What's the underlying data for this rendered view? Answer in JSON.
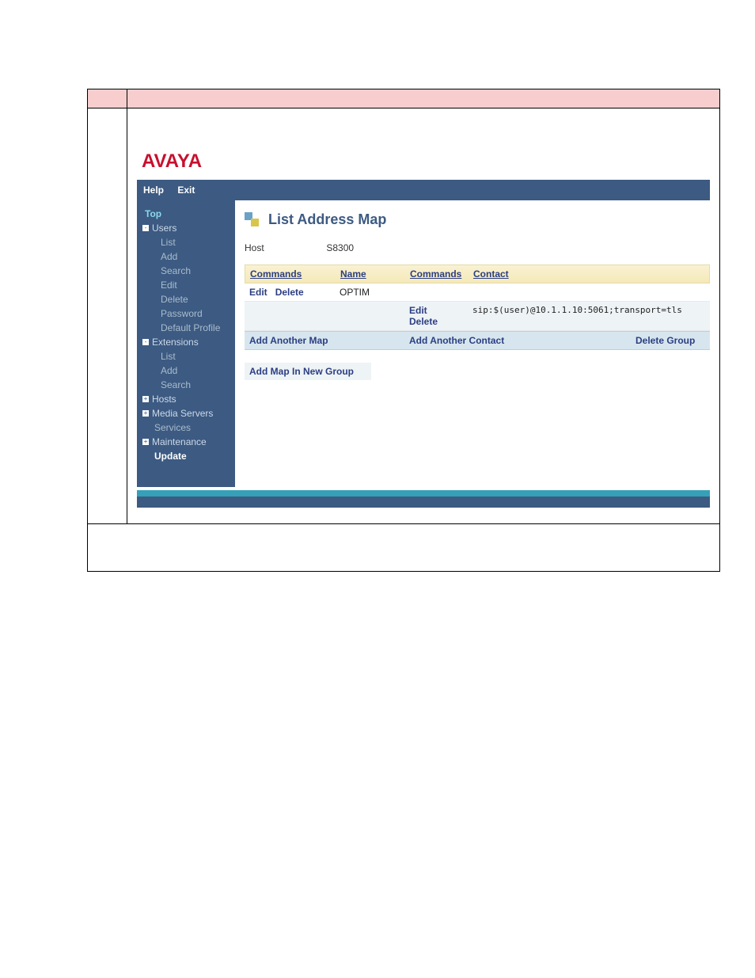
{
  "logo_text": "AVAYA",
  "menubar": {
    "help": "Help",
    "exit": "Exit"
  },
  "sidebar": {
    "top": "Top",
    "users": {
      "label": "Users",
      "items": [
        "List",
        "Add",
        "Search",
        "Edit",
        "Delete",
        "Password",
        "Default Profile"
      ]
    },
    "extensions": {
      "label": "Extensions",
      "items": [
        "List",
        "Add",
        "Search"
      ]
    },
    "hosts": {
      "label": "Hosts"
    },
    "media_servers": {
      "label": "Media Servers"
    },
    "services": {
      "label": "Services"
    },
    "maintenance": {
      "label": "Maintenance"
    },
    "update": "Update"
  },
  "page": {
    "title": "List Address Map",
    "host_label": "Host",
    "host_value": "S8300",
    "headers": {
      "commands1": "Commands",
      "name": "Name",
      "commands2": "Commands",
      "contact": "Contact"
    },
    "map_row": {
      "edit": "Edit",
      "delete": "Delete",
      "name": "OPTIM"
    },
    "contact_row": {
      "edit": "Edit",
      "delete": "Delete",
      "contact": "sip:$(user)@10.1.1.10:5061;transport=tls"
    },
    "actions": {
      "add_map": "Add Another Map",
      "add_contact": "Add Another Contact",
      "delete_group": "Delete Group",
      "add_new_group": "Add Map In New Group"
    }
  }
}
